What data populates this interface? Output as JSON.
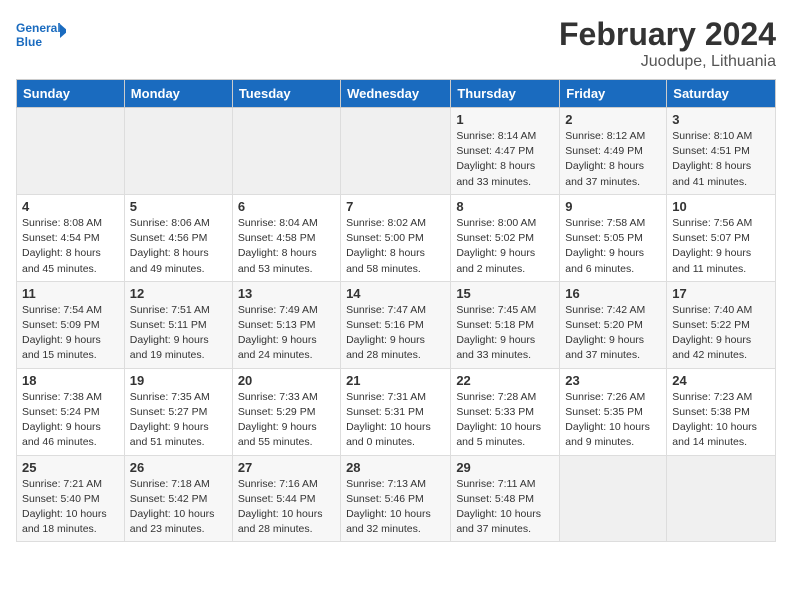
{
  "header": {
    "logo_line1": "General",
    "logo_line2": "Blue",
    "month_year": "February 2024",
    "location": "Juodupe, Lithuania"
  },
  "weekdays": [
    "Sunday",
    "Monday",
    "Tuesday",
    "Wednesday",
    "Thursday",
    "Friday",
    "Saturday"
  ],
  "weeks": [
    [
      {
        "day": "",
        "info": ""
      },
      {
        "day": "",
        "info": ""
      },
      {
        "day": "",
        "info": ""
      },
      {
        "day": "",
        "info": ""
      },
      {
        "day": "1",
        "info": "Sunrise: 8:14 AM\nSunset: 4:47 PM\nDaylight: 8 hours\nand 33 minutes."
      },
      {
        "day": "2",
        "info": "Sunrise: 8:12 AM\nSunset: 4:49 PM\nDaylight: 8 hours\nand 37 minutes."
      },
      {
        "day": "3",
        "info": "Sunrise: 8:10 AM\nSunset: 4:51 PM\nDaylight: 8 hours\nand 41 minutes."
      }
    ],
    [
      {
        "day": "4",
        "info": "Sunrise: 8:08 AM\nSunset: 4:54 PM\nDaylight: 8 hours\nand 45 minutes."
      },
      {
        "day": "5",
        "info": "Sunrise: 8:06 AM\nSunset: 4:56 PM\nDaylight: 8 hours\nand 49 minutes."
      },
      {
        "day": "6",
        "info": "Sunrise: 8:04 AM\nSunset: 4:58 PM\nDaylight: 8 hours\nand 53 minutes."
      },
      {
        "day": "7",
        "info": "Sunrise: 8:02 AM\nSunset: 5:00 PM\nDaylight: 8 hours\nand 58 minutes."
      },
      {
        "day": "8",
        "info": "Sunrise: 8:00 AM\nSunset: 5:02 PM\nDaylight: 9 hours\nand 2 minutes."
      },
      {
        "day": "9",
        "info": "Sunrise: 7:58 AM\nSunset: 5:05 PM\nDaylight: 9 hours\nand 6 minutes."
      },
      {
        "day": "10",
        "info": "Sunrise: 7:56 AM\nSunset: 5:07 PM\nDaylight: 9 hours\nand 11 minutes."
      }
    ],
    [
      {
        "day": "11",
        "info": "Sunrise: 7:54 AM\nSunset: 5:09 PM\nDaylight: 9 hours\nand 15 minutes."
      },
      {
        "day": "12",
        "info": "Sunrise: 7:51 AM\nSunset: 5:11 PM\nDaylight: 9 hours\nand 19 minutes."
      },
      {
        "day": "13",
        "info": "Sunrise: 7:49 AM\nSunset: 5:13 PM\nDaylight: 9 hours\nand 24 minutes."
      },
      {
        "day": "14",
        "info": "Sunrise: 7:47 AM\nSunset: 5:16 PM\nDaylight: 9 hours\nand 28 minutes."
      },
      {
        "day": "15",
        "info": "Sunrise: 7:45 AM\nSunset: 5:18 PM\nDaylight: 9 hours\nand 33 minutes."
      },
      {
        "day": "16",
        "info": "Sunrise: 7:42 AM\nSunset: 5:20 PM\nDaylight: 9 hours\nand 37 minutes."
      },
      {
        "day": "17",
        "info": "Sunrise: 7:40 AM\nSunset: 5:22 PM\nDaylight: 9 hours\nand 42 minutes."
      }
    ],
    [
      {
        "day": "18",
        "info": "Sunrise: 7:38 AM\nSunset: 5:24 PM\nDaylight: 9 hours\nand 46 minutes."
      },
      {
        "day": "19",
        "info": "Sunrise: 7:35 AM\nSunset: 5:27 PM\nDaylight: 9 hours\nand 51 minutes."
      },
      {
        "day": "20",
        "info": "Sunrise: 7:33 AM\nSunset: 5:29 PM\nDaylight: 9 hours\nand 55 minutes."
      },
      {
        "day": "21",
        "info": "Sunrise: 7:31 AM\nSunset: 5:31 PM\nDaylight: 10 hours\nand 0 minutes."
      },
      {
        "day": "22",
        "info": "Sunrise: 7:28 AM\nSunset: 5:33 PM\nDaylight: 10 hours\nand 5 minutes."
      },
      {
        "day": "23",
        "info": "Sunrise: 7:26 AM\nSunset: 5:35 PM\nDaylight: 10 hours\nand 9 minutes."
      },
      {
        "day": "24",
        "info": "Sunrise: 7:23 AM\nSunset: 5:38 PM\nDaylight: 10 hours\nand 14 minutes."
      }
    ],
    [
      {
        "day": "25",
        "info": "Sunrise: 7:21 AM\nSunset: 5:40 PM\nDaylight: 10 hours\nand 18 minutes."
      },
      {
        "day": "26",
        "info": "Sunrise: 7:18 AM\nSunset: 5:42 PM\nDaylight: 10 hours\nand 23 minutes."
      },
      {
        "day": "27",
        "info": "Sunrise: 7:16 AM\nSunset: 5:44 PM\nDaylight: 10 hours\nand 28 minutes."
      },
      {
        "day": "28",
        "info": "Sunrise: 7:13 AM\nSunset: 5:46 PM\nDaylight: 10 hours\nand 32 minutes."
      },
      {
        "day": "29",
        "info": "Sunrise: 7:11 AM\nSunset: 5:48 PM\nDaylight: 10 hours\nand 37 minutes."
      },
      {
        "day": "",
        "info": ""
      },
      {
        "day": "",
        "info": ""
      }
    ]
  ]
}
